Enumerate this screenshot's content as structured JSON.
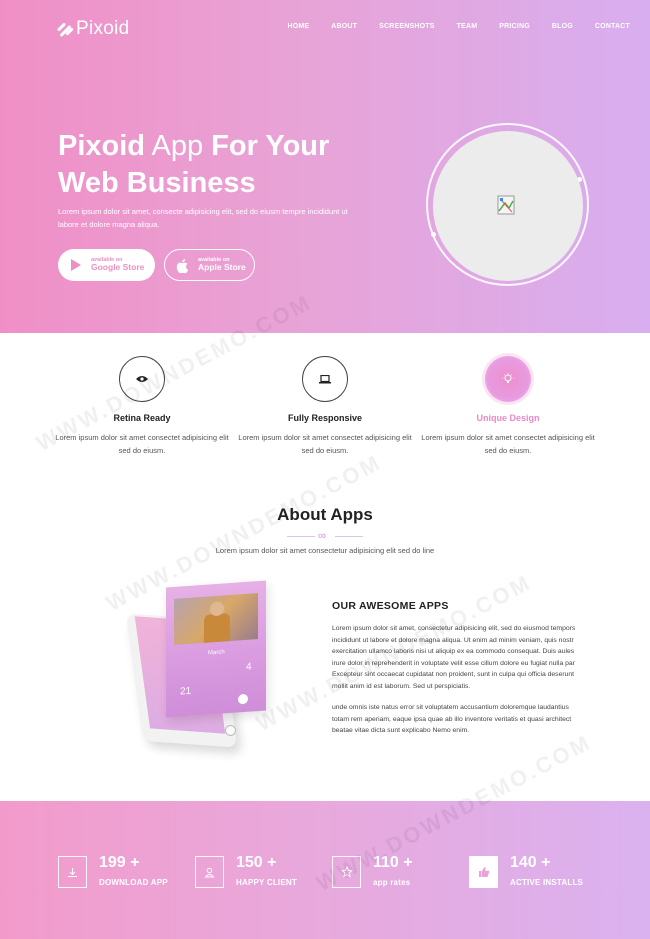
{
  "header": {
    "logo_text": "Pixoid",
    "nav": [
      "HOME",
      "ABOUT",
      "SCREENSHOTS",
      "TEAM",
      "PRICING",
      "BLOG",
      "CONTACT"
    ]
  },
  "hero": {
    "title_bold_1": "Pixoid",
    "title_thin": " App ",
    "title_bold_2": "For Your",
    "title_line2": "Web Business",
    "description": "Lorem ipsum dolor sit amet, consecte adipisicing elit, sed do eiusm tempre incididunt ut labore et dolore magna aliqua.",
    "google_small": "available on",
    "google_big": "Google Store",
    "apple_small": "available on",
    "apple_big": "Apple Store"
  },
  "features": [
    {
      "title": "Retina Ready",
      "desc": "Lorem ipsum dolor sit amet consectet adipisicing elit sed do eiusm.",
      "icon": "eye-icon"
    },
    {
      "title": "Fully Responsive",
      "desc": "Lorem ipsum dolor sit amet consectet adipisicing elit sed do eiusm.",
      "icon": "laptop-icon"
    },
    {
      "title": "Unique Design",
      "desc": "Lorem ipsum dolor sit amet consectet adipisicing elit sed do eiusm.",
      "icon": "bulb-icon"
    }
  ],
  "about": {
    "title": "About Apps",
    "subtitle": "Lorem ipsum dolor sit amet consectetur adipisicing elit sed do line",
    "phone_screen": {
      "month": "March",
      "num_left": "21",
      "num_right": "4"
    },
    "awesome_title": "OUR AWESOME APPS",
    "paragraph_1": "Lorem ipsum dolor sit amet, consectetur adipisicing elit, sed do eiusmod tempors incididunt ut labore et dolore magna aliqua. Ut enim ad minim veniam, quis nostr exercitation ullamco laboris nisi ut aliquip ex ea commodo consequat. Duis aules irure dolor in reprehenderit in voluptate velit esse cillum dolore eu fugiat nulla par Excepteur sint occaecat cupidatat non proident, sunt in culpa qui officia deserunt mollit anim id est laborum. Sed ut perspiciatis.",
    "paragraph_2": "unde omnis iste natus error sit voluptatem accusantium doloremque laudantius totam rem aperiam, eaque ipsa quae ab illo inventore veritatis et quasi architect beatae vitae dicta sunt explicabo Nemo enim."
  },
  "stats": [
    {
      "number": "199 +",
      "label": "DOWNLOAD APP",
      "icon": "download-icon"
    },
    {
      "number": "150 +",
      "label": "HAPPY CLIENT",
      "icon": "user-icon"
    },
    {
      "number": "110 +",
      "label": "app rates",
      "icon": "star-icon"
    },
    {
      "number": "140 +",
      "label": "ACTIVE INSTALLS",
      "icon": "thumbs-up-icon"
    }
  ],
  "watermark": "WWW.DOWNDEMO.COM",
  "colors": {
    "accent": "#e889c8",
    "gradient_start": "#f08fc6",
    "gradient_end": "#d8aef0"
  }
}
